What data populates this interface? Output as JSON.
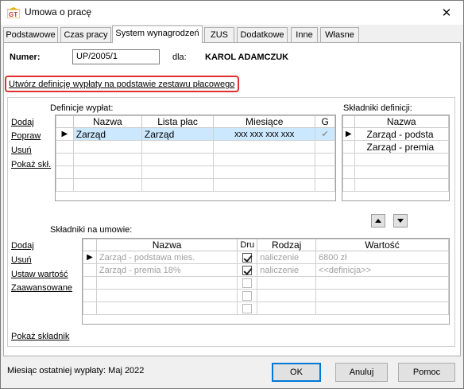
{
  "window": {
    "title": "Umowa o pracę",
    "close_glyph": "✕"
  },
  "tabs": [
    {
      "label": "Podstawowe"
    },
    {
      "label": "Czas pracy"
    },
    {
      "label": "System wynagrodzeń"
    },
    {
      "label": "ZUS"
    },
    {
      "label": "Dodatkowe"
    },
    {
      "label": "Inne"
    },
    {
      "label": "Własne"
    }
  ],
  "header": {
    "numer_label": "Numer:",
    "numer_value": "UP/2005/1",
    "dla_label": "dla:",
    "employee_name": "KAROL ADAMCZUK"
  },
  "template_link": "Utwórz definicję wypłaty na podstawie zestawu płacowego",
  "definitions": {
    "section_label": "Definicje wypłat:",
    "actions": [
      "Dodaj",
      "Popraw",
      "Usuń",
      "Pokaż skł."
    ],
    "columns": [
      "Nazwa",
      "Lista płac",
      "Miesiące",
      "G"
    ],
    "rows": [
      {
        "nazwa": "Zarząd",
        "lista": "Zarząd",
        "miesiace": "xxx xxx xxx xxx",
        "checked": true
      }
    ]
  },
  "components_def": {
    "section_label": "Składniki definicji:",
    "column": "Nazwa",
    "rows": [
      "Zarząd - podsta",
      "Zarząd - premia"
    ]
  },
  "contract_components": {
    "section_label": "Składniki na umowie:",
    "actions": [
      "Dodaj",
      "Usuń",
      "Ustaw wartość",
      "Zaawansowane"
    ],
    "columns": [
      "Nazwa",
      "Dru",
      "Rodzaj",
      "Wartość"
    ],
    "rows": [
      {
        "nazwa": "Zarząd - podstawa mies.",
        "checked": true,
        "rodzaj": "naliczenie",
        "wartosc": "6800 zł"
      },
      {
        "nazwa": "Zarząd - premia 18%",
        "checked": true,
        "rodzaj": "naliczenie",
        "wartosc": "<<definicja>>"
      }
    ],
    "show_link": "Pokaż składnik"
  },
  "footer": {
    "status": "Miesiąc ostatniej wypłaty: Maj 2022",
    "ok": "OK",
    "cancel": "Anuluj",
    "help": "Pomoc"
  }
}
